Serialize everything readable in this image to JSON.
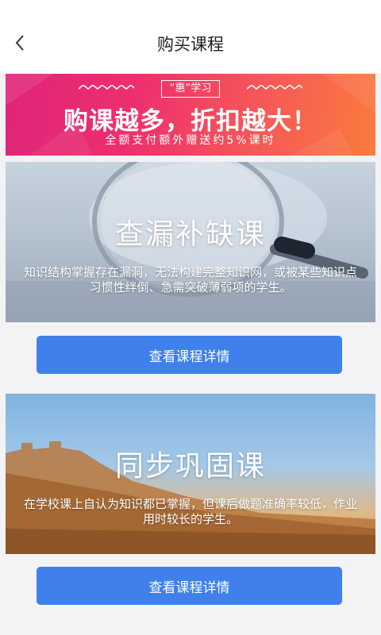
{
  "header": {
    "title": "购买课程",
    "back_icon": "chevron-left-icon"
  },
  "promo": {
    "tag": "“惠”学习",
    "headline": "购课越多，折扣越大！",
    "subtext": "全额支付额外赠送约5%课时"
  },
  "courses": [
    {
      "title": "查漏补缺课",
      "description": "知识结构掌握存在漏洞，无法构建完整知识网，或被某些知识点习惯性绊倒、急需突破薄弱项的学生。",
      "button_label": "查看课程详情",
      "image_icon": "magnifying-glass-icon"
    },
    {
      "title": "同步巩固课",
      "description": "在学校课上自认为知识都已掌握，但课后做题准确率较低，作业用时较长的学生。",
      "button_label": "查看课程详情",
      "image_icon": "great-wall-icon"
    }
  ],
  "colors": {
    "accent": "#3f80ea",
    "promo_start": "#e0247a",
    "promo_end": "#fb7b3d"
  }
}
